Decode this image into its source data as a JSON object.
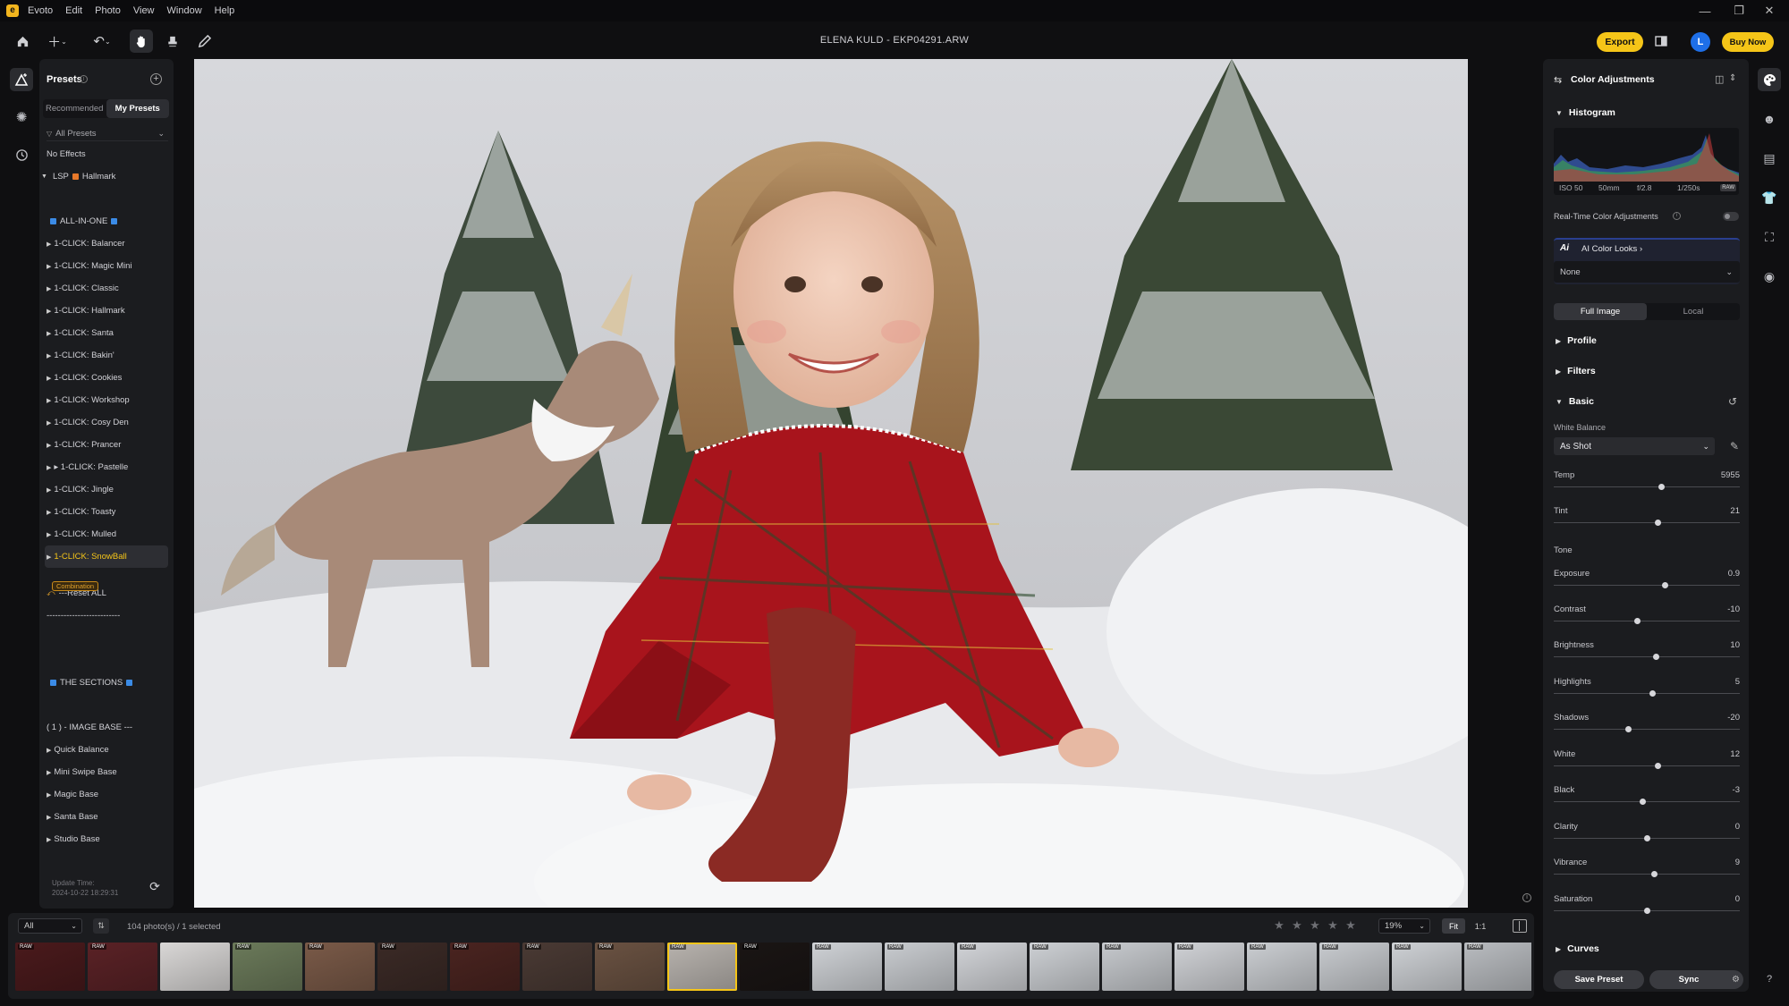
{
  "app": {
    "name": "Evoto",
    "menu": [
      "Edit",
      "Photo",
      "View",
      "Window",
      "Help"
    ],
    "doc_title": "ELENA KULD - EKP04291.ARW",
    "export_label": "Export",
    "avatar_letter": "L",
    "buy_now_label": "Buy Now"
  },
  "presets": {
    "title": "Presets",
    "tabs": [
      "Recommended",
      "My Presets"
    ],
    "active_tab": "My Presets",
    "filter": "All Presets",
    "items": [
      {
        "label": "No Effects",
        "kind": "plain"
      },
      {
        "label": "LSP",
        "suffix": "Hallmark",
        "kind": "group"
      },
      {
        "label": "",
        "kind": "spacer"
      },
      {
        "label": "ALL-IN-ONE",
        "kind": "header"
      },
      {
        "label": "1-CLICK: Balancer",
        "kind": "item"
      },
      {
        "label": "1-CLICK: Magic Mini",
        "kind": "item"
      },
      {
        "label": "1-CLICK: Classic",
        "kind": "item"
      },
      {
        "label": "1-CLICK: Hallmark",
        "kind": "item"
      },
      {
        "label": "1-CLICK: Santa",
        "kind": "item"
      },
      {
        "label": "1-CLICK: Bakin'",
        "kind": "item"
      },
      {
        "label": "1-CLICK: Cookies",
        "kind": "item"
      },
      {
        "label": "1-CLICK: Workshop",
        "kind": "item"
      },
      {
        "label": "1-CLICK: Cosy Den",
        "kind": "item"
      },
      {
        "label": "1-CLICK: Prancer",
        "kind": "item"
      },
      {
        "label": "▸ 1-CLICK: Pastelle",
        "kind": "item"
      },
      {
        "label": "1-CLICK: Jingle",
        "kind": "item"
      },
      {
        "label": "1-CLICK: Toasty",
        "kind": "item"
      },
      {
        "label": "1-CLICK: Mulled",
        "kind": "item"
      },
      {
        "label": "1-CLICK: SnowBall",
        "kind": "selected"
      },
      {
        "label": "",
        "kind": "tagspace"
      },
      {
        "label": "---Reset ALL",
        "kind": "reset"
      },
      {
        "label": "--------------------------",
        "kind": "plain"
      },
      {
        "label": "",
        "kind": "spacer"
      },
      {
        "label": "",
        "kind": "spacer"
      },
      {
        "label": "THE SECTIONS",
        "kind": "header"
      },
      {
        "label": "",
        "kind": "spacer"
      },
      {
        "label": "( 1 ) - IMAGE BASE ---",
        "kind": "plain"
      },
      {
        "label": "Quick Balance",
        "kind": "item"
      },
      {
        "label": "Mini Swipe Base",
        "kind": "item"
      },
      {
        "label": "Magic Base",
        "kind": "item"
      },
      {
        "label": "Santa Base",
        "kind": "item"
      },
      {
        "label": "Studio Base",
        "kind": "item"
      }
    ],
    "combination_tag": "Combination",
    "update_time_label": "Update Time:",
    "update_time_value": "2024-10-22 18:29:31"
  },
  "color_panel": {
    "title": "Color Adjustments",
    "histogram_title": "Histogram",
    "exif": {
      "iso": "ISO 50",
      "focal": "50mm",
      "aperture": "f/2.8",
      "shutter": "1/250s",
      "raw": "RAW"
    },
    "realtime_label": "Real-Time Color Adjustments",
    "ai_looks_label": "AI Color Looks",
    "ai_looks_value": "None",
    "scope_tabs": [
      "Full Image",
      "Local"
    ],
    "sections": {
      "profile": "Profile",
      "filters": "Filters",
      "basic": "Basic",
      "curves": "Curves"
    },
    "white_balance_label": "White Balance",
    "white_balance_value": "As Shot",
    "tone_label": "Tone",
    "sliders": [
      {
        "name": "Temp",
        "value": "5955",
        "pos": 0.58
      },
      {
        "name": "Tint",
        "value": "21",
        "pos": 0.56
      },
      {
        "name": "Exposure",
        "value": "0.9",
        "pos": 0.6
      },
      {
        "name": "Contrast",
        "value": "-10",
        "pos": 0.45
      },
      {
        "name": "Brightness",
        "value": "10",
        "pos": 0.55
      },
      {
        "name": "Highlights",
        "value": "5",
        "pos": 0.53
      },
      {
        "name": "Shadows",
        "value": "-20",
        "pos": 0.4
      },
      {
        "name": "White",
        "value": "12",
        "pos": 0.56
      },
      {
        "name": "Black",
        "value": "-3",
        "pos": 0.48
      },
      {
        "name": "Clarity",
        "value": "0",
        "pos": 0.5
      },
      {
        "name": "Vibrance",
        "value": "9",
        "pos": 0.54
      },
      {
        "name": "Saturation",
        "value": "0",
        "pos": 0.5
      }
    ],
    "save_preset_label": "Save Preset",
    "sync_label": "Sync"
  },
  "filmstrip": {
    "filter_value": "All",
    "count_text": "104 photo(s) / 1 selected",
    "zoom_value": "19%",
    "fit_label": "Fit",
    "one_label": "1:1",
    "raw_badge": "RAW",
    "thumbs": [
      {
        "bg": "#4a1a1c",
        "raw": true
      },
      {
        "bg": "#5a2226",
        "raw": true
      },
      {
        "bg": "#d9d7d6",
        "raw": false
      },
      {
        "bg": "#6b7a5a",
        "raw": true
      },
      {
        "bg": "#7a5a48",
        "raw": true
      },
      {
        "bg": "#3b2a26",
        "raw": true
      },
      {
        "bg": "#4a2420",
        "raw": true
      },
      {
        "bg": "#4a3a34",
        "raw": true
      },
      {
        "bg": "#6a5242",
        "raw": true
      },
      {
        "bg": "#b8b3ae",
        "raw": true,
        "selected": true
      },
      {
        "bg": "#1a1514",
        "raw": true
      },
      {
        "bg": "#cfd2d6",
        "raw": true
      },
      {
        "bg": "#c9ccd0",
        "raw": true
      },
      {
        "bg": "#d2d4d8",
        "raw": true
      },
      {
        "bg": "#cdd0d4",
        "raw": true
      },
      {
        "bg": "#c6c9cd",
        "raw": true
      },
      {
        "bg": "#d0d2d6",
        "raw": true
      },
      {
        "bg": "#cbced2",
        "raw": true
      },
      {
        "bg": "#c8cbcf",
        "raw": true
      },
      {
        "bg": "#ced1d5",
        "raw": true
      },
      {
        "bg": "#b9bcc0",
        "raw": true
      },
      {
        "bg": "#c4c6ca",
        "raw": true
      }
    ]
  },
  "colors": {
    "accent": "#f5c518",
    "bg": "#0f0f11",
    "panel": "#1b1c1f",
    "link_blue": "#1e6fe8"
  }
}
